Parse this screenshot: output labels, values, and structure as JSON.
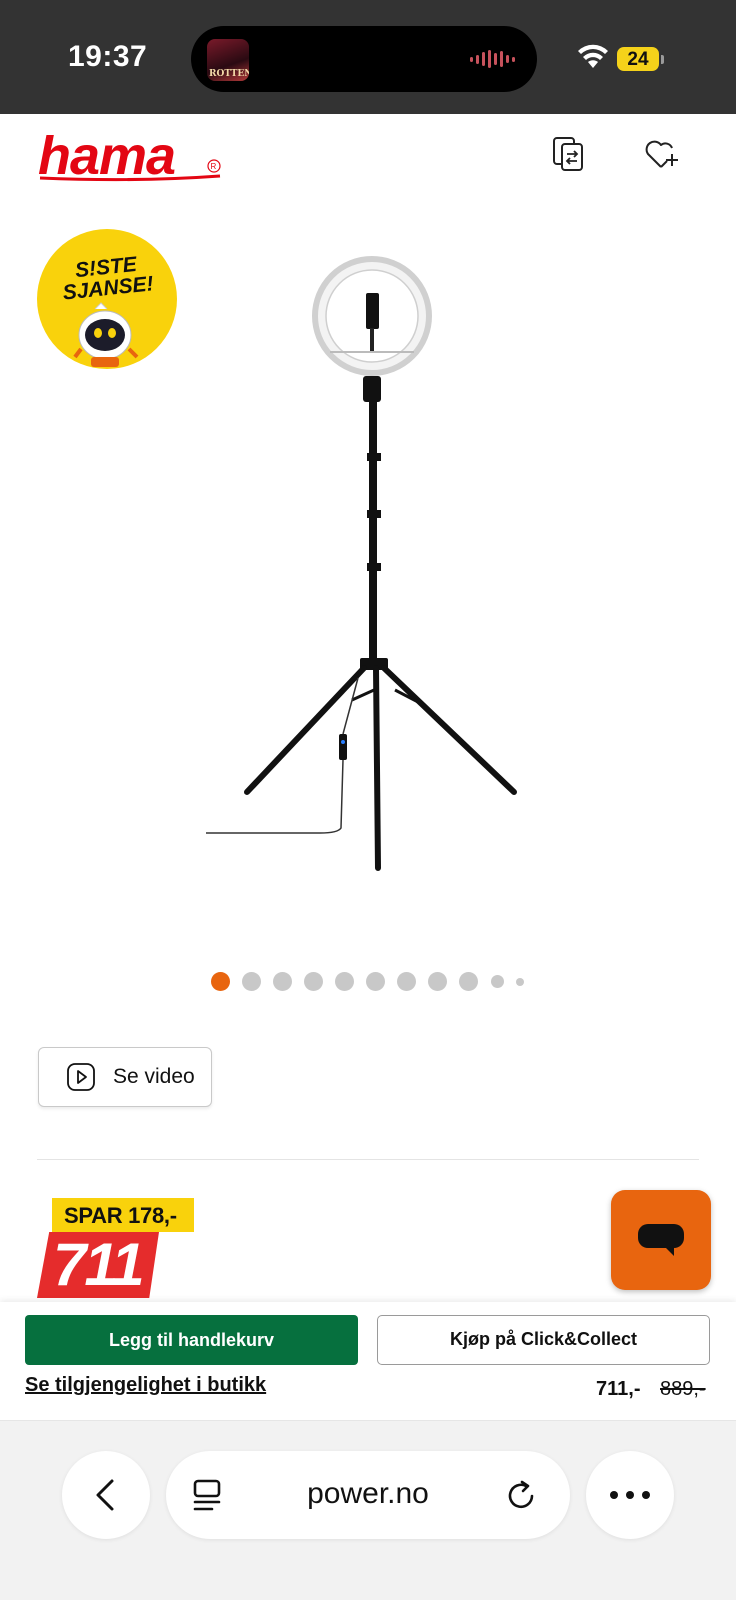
{
  "status_bar": {
    "time": "19:37",
    "battery": "24",
    "now_playing_art_text": "ROTTEN"
  },
  "header": {
    "brand": "hama",
    "icons": [
      "compare-icon",
      "wishlist-add-icon"
    ]
  },
  "badge": {
    "line1": "S!STE",
    "line2": "SJANSE!"
  },
  "gallery": {
    "total_dots": 11,
    "active_index": 0,
    "active_color": "#E8650F"
  },
  "video_button": {
    "label": "Se video"
  },
  "price": {
    "save_label": "SPAR 178,-",
    "big_price": "711",
    "current": "711,-",
    "original": "889,-"
  },
  "actions": {
    "add_to_cart": "Legg til handlekurv",
    "click_collect": "Kjøp på Click&Collect",
    "store_availability": "Se tilgjengelighet i butikk"
  },
  "browser": {
    "url": "power.no"
  },
  "colors": {
    "brand_red": "#E30613",
    "orange": "#E8650F",
    "green": "#06703E",
    "yellow": "#F9D20C",
    "price_red": "#E52C2C"
  }
}
